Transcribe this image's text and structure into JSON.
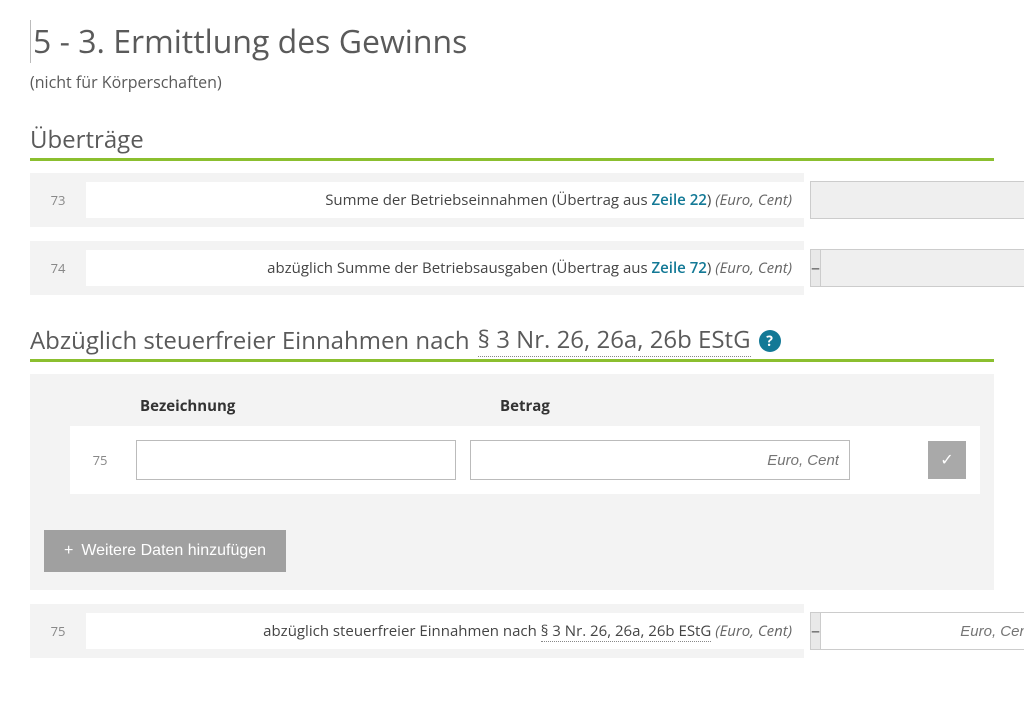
{
  "page": {
    "title": "5 - 3. Ermittlung des Gewinns",
    "subtitle": "(nicht für Körperschaften)"
  },
  "section_uebertraege": {
    "heading": "Überträge",
    "rows": [
      {
        "line": "73",
        "label_pre": "Summe der Betriebseinnahmen (Übertrag aus ",
        "link": "Zeile 22",
        "label_post": ") ",
        "hint": "(Euro, Cent)",
        "has_minus": false,
        "value": ""
      },
      {
        "line": "74",
        "label_pre": "abzüglich Summe der Betriebsausgaben (Übertrag aus ",
        "link": "Zeile 72",
        "label_post": ") ",
        "hint": "(Euro, Cent)",
        "has_minus": true,
        "value": ""
      }
    ]
  },
  "section_steuerfrei": {
    "heading_pre": "Abzüglich steuerfreier Einnahmen nach ",
    "heading_law": "§ 3 Nr. 26, 26a, 26b EStG",
    "cols": {
      "bezeichnung": "Bezeichnung",
      "betrag": "Betrag"
    },
    "entry": {
      "line": "75",
      "bezeichnung": "",
      "betrag": "",
      "betrag_placeholder": "Euro, Cent"
    },
    "add_button": "Weitere Daten hinzufügen",
    "sum_row": {
      "line": "75",
      "label_pre": "abzüglich steuerfreier Einnahmen nach ",
      "law": "§ 3 Nr. 26, 26a, 26b",
      "estg": "EStG",
      "hint": "(Euro, Cent)",
      "placeholder": "Euro, Cent"
    }
  },
  "icons": {
    "help": "?",
    "check": "✓",
    "plus": "+",
    "minus": "–"
  }
}
